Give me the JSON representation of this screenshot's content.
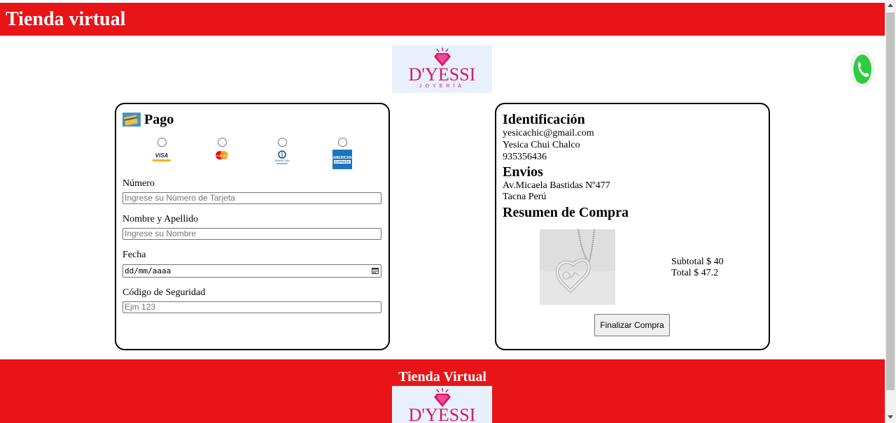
{
  "header": {
    "title": "Tienda virtual"
  },
  "logo": {
    "brand": "D'YESSI",
    "subtitle": "JOYERÍA",
    "icon": "diamond-logo-icon"
  },
  "whatsapp": {
    "icon": "whatsapp-icon"
  },
  "pago": {
    "title": "Pago",
    "icon": "credit-card-icon",
    "methods": [
      {
        "name": "VISA",
        "icon": "visa-icon"
      },
      {
        "name": "MasterCard",
        "icon": "mastercard-icon"
      },
      {
        "name": "Diners Club",
        "icon": "diners-club-icon"
      },
      {
        "name": "AMERICAN EXPRESS",
        "icon": "amex-icon"
      }
    ],
    "fields": {
      "numero_label": "Número",
      "numero_placeholder": "Ingrese su Número de Tarjeta",
      "nombre_label": "Nombre y Apellido",
      "nombre_placeholder": "Ingrese su Nombre",
      "fecha_label": "Fecha",
      "fecha_placeholder": "dd/mm/aaaa",
      "codigo_label": "Código de Seguridad",
      "codigo_placeholder": "Ejm 123"
    }
  },
  "identificacion": {
    "title": "Identificación",
    "email": "yesicachic@gmail.com",
    "name": "Yesica Chui Chalco",
    "phone": "935356436"
  },
  "envios": {
    "title": "Envios",
    "address": "Av.Micaela Bastidas Nº477",
    "city": "Tacna Perú"
  },
  "resumen": {
    "title": "Resumen de Compra",
    "subtotal": "Subtotal $ 40",
    "total": "Total $ 47.2",
    "button": "Finalizar Compra"
  },
  "footer": {
    "title": "Tienda Virtual"
  },
  "colors": {
    "primary": "#e81417",
    "brand": "#d8176a",
    "logo_bg": "#e8f1fb"
  }
}
